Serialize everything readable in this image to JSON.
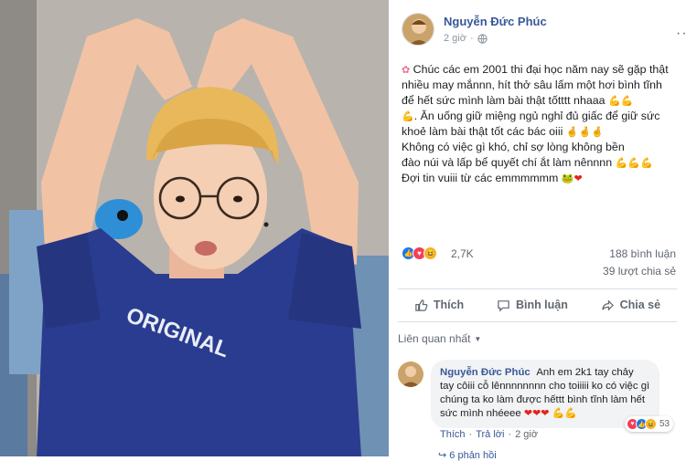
{
  "post": {
    "author": "Nguyễn Đức Phúc",
    "time": "2 giờ",
    "privacy_icon": "globe-icon",
    "lines": [
      "Chúc các em 2001 thi đại học năm nay sẽ gặp thật nhiều may mắnnn, hít thở sâu lấm một hơi bình tĩnh để hết sức mình làm bài thật tốtttt nhaaa",
      ". Ăn uống giữ miệng ngủ nghỉ đủ giấc để giữ sức khoẻ làm bài thật tốt các bác oiii",
      "Không có việc gì khó, chỉ sợ lòng không bền",
      "đào núi và lấp bể quyết chí ắt làm nênnnn",
      "Đợi tin vuiii từ các emmmmmm"
    ]
  },
  "stats": {
    "reactions": "2,7K",
    "comments": "188 bình luận",
    "shares": "39 lượt chia sẻ"
  },
  "actions": {
    "like": "Thích",
    "comment": "Bình luận",
    "share": "Chia sẻ"
  },
  "sort": {
    "label": "Liên quan nhất"
  },
  "comment": {
    "author": "Nguyễn Đức Phúc",
    "text": "Anh em 2k1 tay chảy tay côiii cỗ lênnnnnnnn cho toiiiii ko có việc gì chúng ta ko làm được hếttt bình tĩnh làm hết sức mình nhéeee",
    "reaction_count": "53",
    "like": "Thích",
    "reply": "Trả lời",
    "time": "2 giờ"
  },
  "more_replies": "6 phản hồi",
  "colors": {
    "link_blue": "#385898",
    "like_blue": "#1877f2",
    "love_red": "#f33e58",
    "haha_yellow": "#f7b125"
  }
}
